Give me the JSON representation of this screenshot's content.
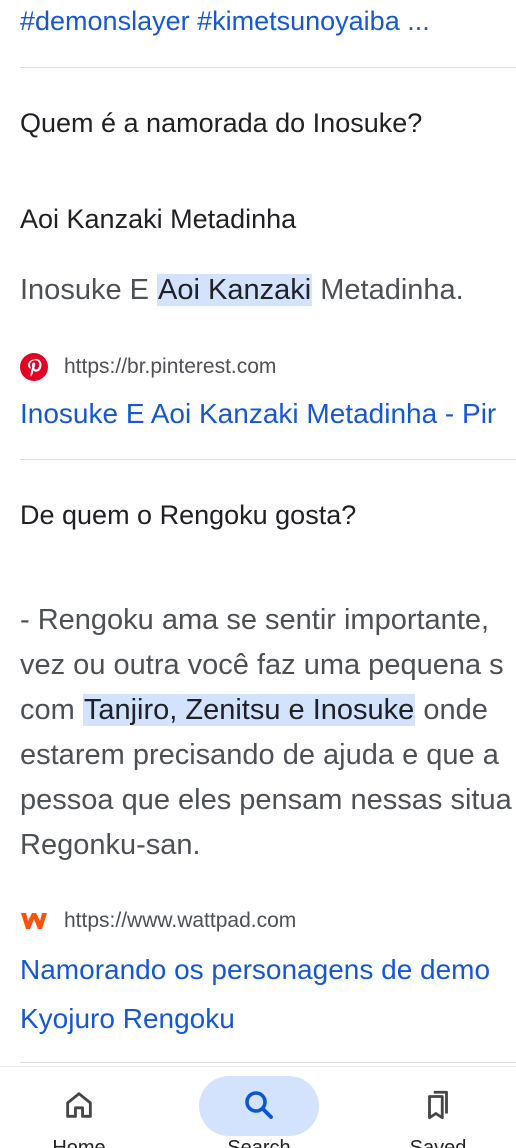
{
  "hashtags": "#demonslayer #kimetsunoyaiba ...",
  "result1": {
    "question": "Quem é a namorada do Inosuke?",
    "answer_title": "Aoi Kanzaki Metadinha",
    "snippet_before": "Inosuke E ",
    "snippet_highlight": "Aoi Kanzaki",
    "snippet_after": " Metadinha.",
    "source_icon": "pinterest-icon",
    "source_url": "https://br.pinterest.com",
    "link_title": "Inosuke E Aoi Kanzaki Metadinha - Pir"
  },
  "result2": {
    "question": "De quem o Rengoku gosta?",
    "line1": "- Rengoku ama se sentir importante,",
    "line2": "vez ou outra você faz uma pequena s",
    "line3_before": "com ",
    "line3_highlight": "Tanjiro, Zenitsu e Inosuke",
    "line3_after": " onde",
    "line4": "estarem precisando de ajuda e que a",
    "line5": "pessoa que eles pensam nessas situa",
    "line6": "Regonku-san.",
    "source_icon": "wattpad-icon",
    "source_url": "https://www.wattpad.com",
    "link_line1": "Namorando os personagens de demo",
    "link_line2": "Kyojuro Rengoku"
  },
  "bottom_nav": {
    "items": [
      {
        "icon": "home-icon",
        "label": "Home"
      },
      {
        "icon": "search-icon",
        "label": "Search"
      },
      {
        "icon": "saved-icon",
        "label": "Saved"
      }
    ],
    "active_color": "#d3e3fd"
  },
  "colors": {
    "link": "#1558d6",
    "highlight": "#d3e3fd",
    "pinterest": "#e60023",
    "wattpad": "#ff500a"
  }
}
